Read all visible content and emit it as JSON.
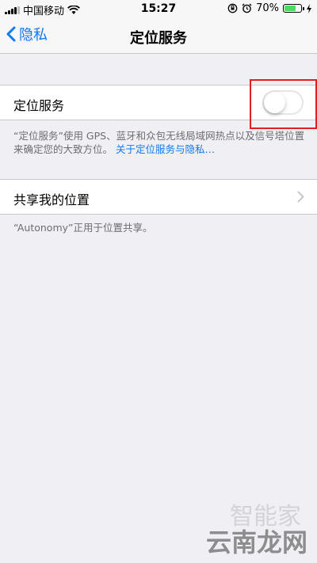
{
  "status_bar": {
    "carrier": "中国移动",
    "time": "15:27",
    "battery_percent": "70%",
    "battery_level": 0.7,
    "icons": [
      "signal-bars-icon",
      "wifi-icon",
      "rotation-lock-icon",
      "alarm-icon",
      "battery-icon",
      "charging-icon"
    ]
  },
  "nav": {
    "back_label": "隐私",
    "title": "定位服务"
  },
  "location_services": {
    "label": "定位服务",
    "enabled": false,
    "footnote": "“定位服务”使用 GPS、蓝牙和众包无线局域网热点以及信号塔位置来确定您的大致方位。",
    "link_text": "关于定位服务与隐私…"
  },
  "share_location": {
    "label": "共享我的位置",
    "footnote": "“Autonomy”正用于位置共享。"
  },
  "watermark": {
    "text": "云南龙网",
    "logo_text": "智能家"
  },
  "colors": {
    "accent": "#1478f6",
    "background": "#efeff4",
    "highlight": "#e02020"
  }
}
